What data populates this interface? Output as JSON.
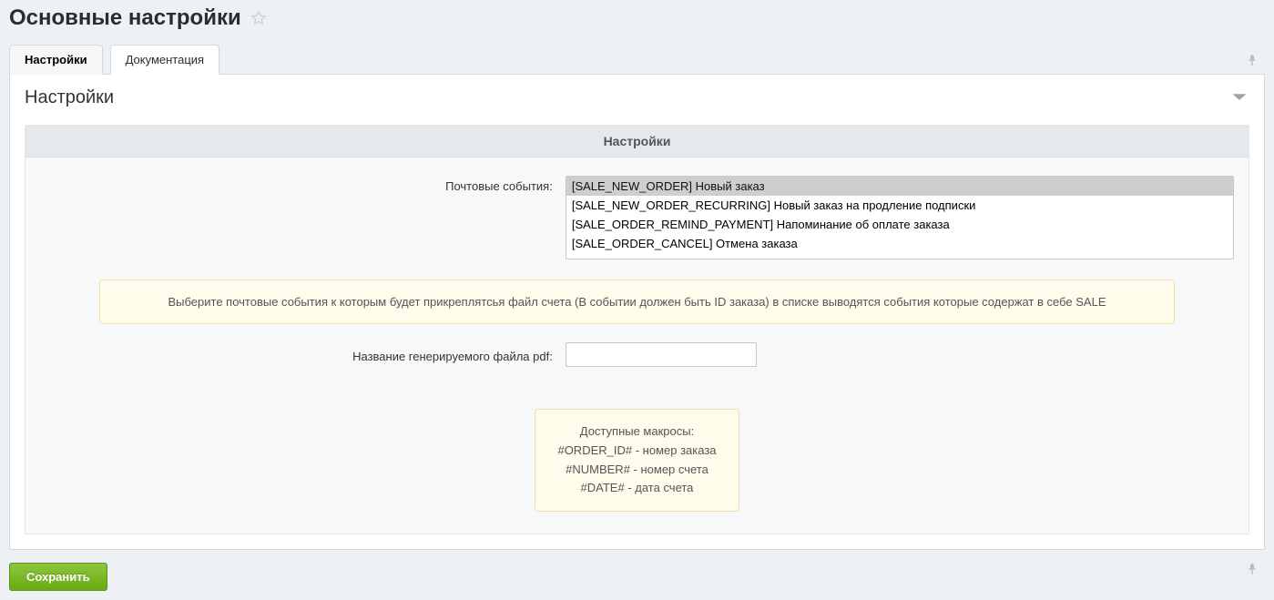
{
  "page_title": "Основные настройки",
  "tabs": {
    "settings": "Настройки",
    "docs": "Документация"
  },
  "panel_title": "Настройки",
  "section_title": "Настройки",
  "mail_events": {
    "label": "Почтовые события:",
    "options": [
      "[SALE_NEW_ORDER] Новый заказ",
      "[SALE_NEW_ORDER_RECURRING] Новый заказ на продление подписки",
      "[SALE_ORDER_REMIND_PAYMENT] Напоминание об оплате заказа",
      "[SALE_ORDER_CANCEL] Отмена заказа"
    ]
  },
  "hint1": "Выберите почтовые события к которым будет прикреплятсья файл счета (В событии должен быть ID заказа) в списке выводятся события которые содержат в себе SALE",
  "pdf_name": {
    "label": "Название генерируемого файла pdf:",
    "value": ""
  },
  "macros": {
    "title": "Доступные макросы:",
    "lines": [
      "#ORDER_ID# - номер заказа",
      "#NUMBER# - номер счета",
      "#DATE# - дата счета"
    ]
  },
  "save_label": "Сохранить"
}
